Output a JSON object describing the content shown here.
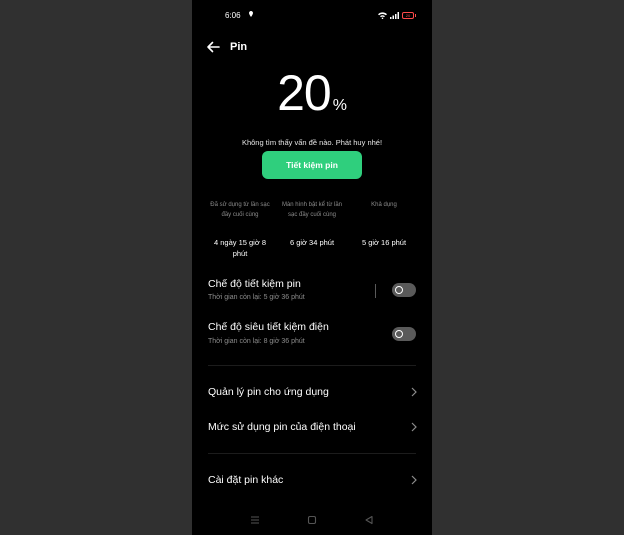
{
  "status_bar": {
    "time": "6:06",
    "battery_level": "20"
  },
  "header": {
    "title": "Pin"
  },
  "battery": {
    "percent": "20",
    "percent_sign": "%",
    "message": "Không tìm thấy vấn đề nào. Phát huy nhé!",
    "save_button_label": "Tiết kiệm pin"
  },
  "stats": [
    {
      "label": "Đã sử dụng từ lần sạc đầy cuối cùng",
      "value": "4 ngày 15 giờ 8 phút"
    },
    {
      "label": "Màn hình bật kể từ lần sạc đầy cuối cùng",
      "value": "6 giờ 34 phút"
    },
    {
      "label": "Khả dụng",
      "value": "5 giờ 16 phút"
    }
  ],
  "modes": [
    {
      "title": "Chế độ tiết kiệm pin",
      "subtitle": "Thời gian còn lại:  5 giờ 36 phút",
      "enabled": false
    },
    {
      "title": "Chế độ siêu tiết kiệm điện",
      "subtitle": "Thời gian còn lại:  8 giờ 36 phút",
      "enabled": false
    }
  ],
  "links": [
    {
      "label": "Quản lý pin cho ứng dụng"
    },
    {
      "label": "Mức sử dụng pin của điện thoại"
    },
    {
      "label": "Cài đặt pin khác"
    }
  ],
  "colors": {
    "accent": "#2fcf7d",
    "background": "#000000",
    "battery_low": "#ff4a4a"
  },
  "icons": [
    "location-icon",
    "wifi-icon",
    "signal-icon",
    "battery-icon",
    "back-arrow-icon",
    "chevron-right-icon",
    "menu-nav-icon",
    "home-nav-icon",
    "back-nav-icon"
  ]
}
